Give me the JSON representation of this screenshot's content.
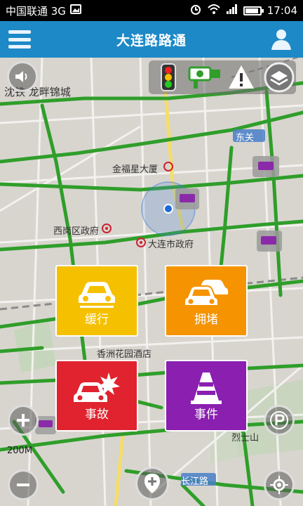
{
  "status_bar": {
    "carrier": "中国联通 3G",
    "time": "17:04"
  },
  "header": {
    "title": "大连路路通"
  },
  "map": {
    "labels": {
      "shenyang": "沈铁 龙畔锦城",
      "dongguan": "东关",
      "jinfuxing": "金福星大厦",
      "xigang_gov": "西岗区政府",
      "dalian_gov": "大连市政府",
      "xiangzhou": "香洲花园酒店",
      "lieshi": "烈士山",
      "changjiang": "长江路"
    },
    "scale": "200M"
  },
  "report_tiles": {
    "slow": "缓行",
    "jam": "拥堵",
    "accident": "事故",
    "event": "事件"
  },
  "colors": {
    "header": "#1d89c7",
    "slow": "#f5c000",
    "jam": "#f59300",
    "accident": "#e0232e",
    "event": "#8a1fb0",
    "road_green": "#2f9e2a"
  }
}
